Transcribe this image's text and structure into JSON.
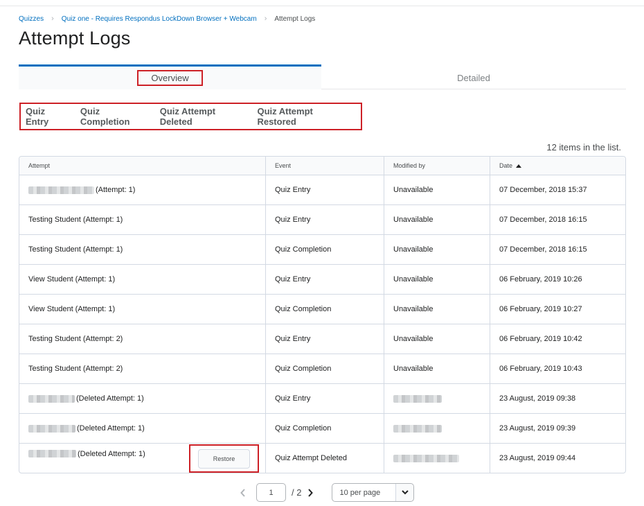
{
  "breadcrumb": {
    "items": [
      "Quizzes",
      "Quiz one - Requires Respondus LockDown Browser + Webcam",
      "Attempt Logs"
    ]
  },
  "page_title": "Attempt Logs",
  "tabs": [
    {
      "label": "Overview",
      "active": true
    },
    {
      "label": "Detailed",
      "active": false
    }
  ],
  "filters": [
    "Quiz Entry",
    "Quiz Completion",
    "Quiz Attempt Deleted",
    "Quiz Attempt Restored"
  ],
  "item_count": "12 items in the list.",
  "table": {
    "columns": [
      "Attempt",
      "Event",
      "Modified by",
      "Date"
    ],
    "sorted_column": "Date",
    "rows": [
      {
        "attempt": "(Attempt: 1)",
        "attempt_name_redacted": true,
        "event": "Quiz Entry",
        "modified_by": "Unavailable",
        "modified_by_redacted": false,
        "date": "07 December, 2018 15:37"
      },
      {
        "attempt": "Testing Student (Attempt: 1)",
        "attempt_name_redacted": false,
        "event": "Quiz Entry",
        "modified_by": "Unavailable",
        "modified_by_redacted": false,
        "date": "07 December, 2018 16:15"
      },
      {
        "attempt": "Testing Student (Attempt: 1)",
        "attempt_name_redacted": false,
        "event": "Quiz Completion",
        "modified_by": "Unavailable",
        "modified_by_redacted": false,
        "date": "07 December, 2018 16:15"
      },
      {
        "attempt": "View Student (Attempt: 1)",
        "attempt_name_redacted": false,
        "event": "Quiz Entry",
        "modified_by": "Unavailable",
        "modified_by_redacted": false,
        "date": "06 February, 2019 10:26"
      },
      {
        "attempt": "View Student (Attempt: 1)",
        "attempt_name_redacted": false,
        "event": "Quiz Completion",
        "modified_by": "Unavailable",
        "modified_by_redacted": false,
        "date": "06 February, 2019 10:27"
      },
      {
        "attempt": "Testing Student (Attempt: 2)",
        "attempt_name_redacted": false,
        "event": "Quiz Entry",
        "modified_by": "Unavailable",
        "modified_by_redacted": false,
        "date": "06 February, 2019 10:42"
      },
      {
        "attempt": "Testing Student (Attempt: 2)",
        "attempt_name_redacted": false,
        "event": "Quiz Completion",
        "modified_by": "Unavailable",
        "modified_by_redacted": false,
        "date": "06 February, 2019 10:43"
      },
      {
        "attempt": "(Deleted Attempt: 1)",
        "attempt_name_redacted": true,
        "event": "Quiz Entry",
        "modified_by": "",
        "modified_by_redacted": true,
        "date": "23 August, 2019 09:38"
      },
      {
        "attempt": "(Deleted Attempt: 1)",
        "attempt_name_redacted": true,
        "event": "Quiz Completion",
        "modified_by": "",
        "modified_by_redacted": true,
        "date": "23 August, 2019 09:39"
      },
      {
        "attempt": "(Deleted Attempt: 1)",
        "attempt_name_redacted": true,
        "event": "Quiz Attempt Deleted",
        "modified_by": "",
        "modified_by_redacted": true,
        "date": "23 August, 2019 09:44",
        "has_restore": true
      }
    ],
    "restore_label": "Restore"
  },
  "pagination": {
    "current_page": "1",
    "total": "/ 2",
    "per_page": "10 per page"
  },
  "colors": {
    "accent": "#006fbf",
    "highlight": "#cd2026",
    "border": "#d3d9e3"
  }
}
